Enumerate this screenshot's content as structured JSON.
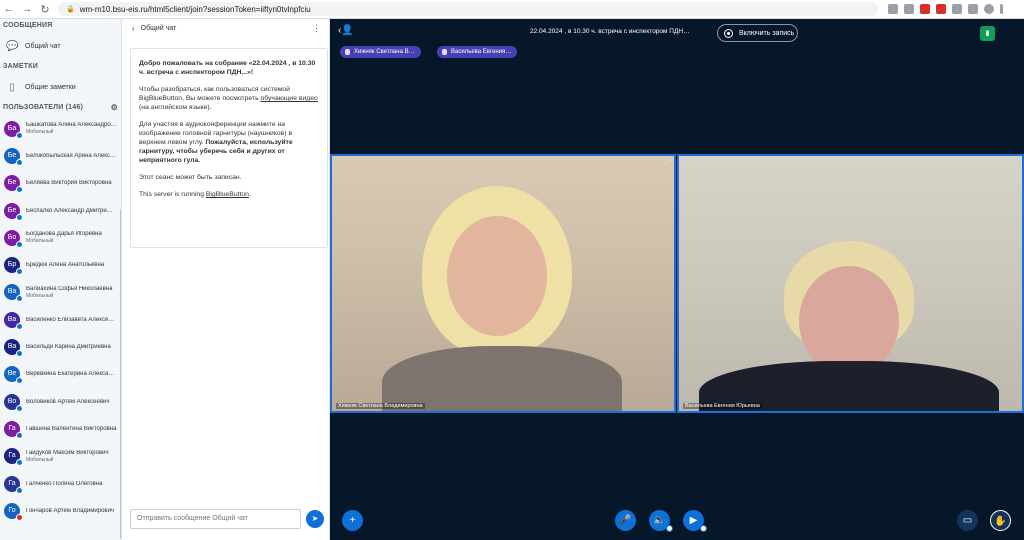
{
  "browser": {
    "url": "wm-m10.bsu-eis.ru/html5client/join?sessionToken=iiftyn0tvlnpfciu"
  },
  "sidebar": {
    "messages_title": "СООБЩЕНИЯ",
    "public_chat": "Общий чат",
    "notes_title": "ЗАМЕТКИ",
    "shared_notes": "Общие заметки",
    "users_title": "ПОЛЬЗОВАТЕЛИ (146)",
    "users": [
      {
        "initials": "Ба",
        "name": "Башкатова Алина Александро…",
        "sub": "Мобильный",
        "color": "#7b1fa2",
        "status": "blue"
      },
      {
        "initials": "Бе",
        "name": "Белокобыльская Арина Алекс…",
        "sub": "",
        "color": "#1565c0",
        "status": "blue"
      },
      {
        "initials": "Бе",
        "name": "Беляева Виктория Викторовна",
        "sub": "",
        "color": "#7b1fa2",
        "status": "blue"
      },
      {
        "initials": "Бе",
        "name": "Беспалко Александр Дмитри…",
        "sub": "",
        "color": "#7b1fa2",
        "status": "blue"
      },
      {
        "initials": "Бо",
        "name": "Богданова Дарья Игоревна",
        "sub": "Мобильный",
        "color": "#7b1fa2",
        "status": "blue"
      },
      {
        "initials": "Бр",
        "name": "Бредюк Алёна Анатольевна",
        "sub": "",
        "color": "#1a237e",
        "status": "blue"
      },
      {
        "initials": "Ва",
        "name": "Валиахина Софья Николаевна",
        "sub": "Мобильный",
        "color": "#1565c0",
        "status": "blue"
      },
      {
        "initials": "Ва",
        "name": "Василенко Елизавета Алексе…",
        "sub": "",
        "color": "#4527a0",
        "status": "blue"
      },
      {
        "initials": "Ва",
        "name": "Васильди Карина Дмитриевна",
        "sub": "",
        "color": "#1a237e",
        "status": "blue"
      },
      {
        "initials": "Ве",
        "name": "Верёвкина Екатерина Алекса…",
        "sub": "",
        "color": "#1565c0",
        "status": "blue"
      },
      {
        "initials": "Во",
        "name": "Воловиков Артём Алексеевич",
        "sub": "",
        "color": "#283593",
        "status": "blue"
      },
      {
        "initials": "Га",
        "name": "Гавшина Валентина Викторовна",
        "sub": "",
        "color": "#7b1fa2",
        "status": "blue"
      },
      {
        "initials": "Га",
        "name": "Гайдуков Максим Викторович",
        "sub": "Мобильный",
        "color": "#1a237e",
        "status": "blue"
      },
      {
        "initials": "Га",
        "name": "Галченко Полина Олеговна",
        "sub": "",
        "color": "#283593",
        "status": "blue"
      },
      {
        "initials": "Го",
        "name": "Гончаров Артём Владимирович",
        "sub": "",
        "color": "#1565c0",
        "status": "red"
      }
    ]
  },
  "chat": {
    "header": "Общий чат",
    "welcome_line1": "Добро пожаловать на собрание «22.04.2024 , в 10.30 ч. встреча с инспектором ПДН...»!",
    "welcome_line2a": "Чтобы разобраться, как пользоваться системой BigBlueButton, Вы можете посмотреть ",
    "welcome_link": "обучающие видео",
    "welcome_line2b": " (на английском языке).",
    "welcome_line3a": "Для участия в аудиоконференции нажмите на изображение головной гарнитуры (наушников) в верхнем левом углу. ",
    "welcome_line3b": "Пожалуйста, используйте гарнитуру, чтобы уберечь себя и других от неприятного гула.",
    "welcome_line4": "Этот сеанс может быть записан.",
    "welcome_line5a": "This server is running ",
    "welcome_line5b": "BigBlueButton",
    "welcome_line5c": ".",
    "input_placeholder": "Отправить сообщение Общий чат"
  },
  "main": {
    "title": "22.04.2024 , в 10.30 ч. встреча с инспектором ПДН…",
    "record_label": "Включить запись",
    "talkers": [
      "Хижняк Светлана В…",
      "Васильева Евгения…"
    ],
    "videos": [
      {
        "name": "Хижняк Светлана Владимировна"
      },
      {
        "name": "Васильева Евгения Юрьевна"
      }
    ]
  }
}
